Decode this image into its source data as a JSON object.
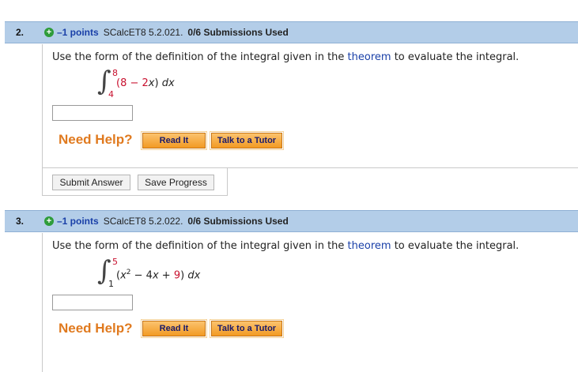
{
  "questions": [
    {
      "number": "2.",
      "points": "–1 points",
      "code": "SCalcET8 5.2.021.",
      "submissions": "0/6 Submissions Used",
      "prompt_before": "Use the form of the definition of the integral given in the ",
      "prompt_link": "theorem",
      "prompt_after": " to evaluate the integral.",
      "integral": {
        "upper": "8",
        "lower": "4",
        "expr_open": "(8 − 2",
        "expr_var": "x",
        "expr_close": ") ",
        "dx": "dx"
      },
      "answer_value": "",
      "need_help": "Need Help?",
      "read_it": "Read It",
      "talk_tutor": "Talk to a Tutor",
      "submit_answer": "Submit Answer",
      "save_progress": "Save Progress"
    },
    {
      "number": "3.",
      "points": "–1 points",
      "code": "SCalcET8 5.2.022.",
      "submissions": "0/6 Submissions Used",
      "prompt_before": "Use the form of the definition of the integral given in the ",
      "prompt_link": "theorem",
      "prompt_after": " to evaluate the integral.",
      "integral": {
        "upper": "5",
        "lower": "1",
        "expr_open": "(",
        "expr_var": "x",
        "expr_exp": "2",
        "expr_mid": " − 4",
        "expr_var2": "x",
        "expr_plus": " + ",
        "expr_const": "9",
        "expr_close": ") ",
        "dx": "dx"
      },
      "answer_value": "",
      "need_help": "Need Help?",
      "read_it": "Read It",
      "talk_tutor": "Talk to a Tutor"
    }
  ],
  "colors": {
    "header_bg": "#b3cde8",
    "points_blue": "#1a40a8",
    "help_orange": "#e07a1f",
    "limit_red": "#c8102e",
    "plus_green": "#2e9c3a"
  }
}
